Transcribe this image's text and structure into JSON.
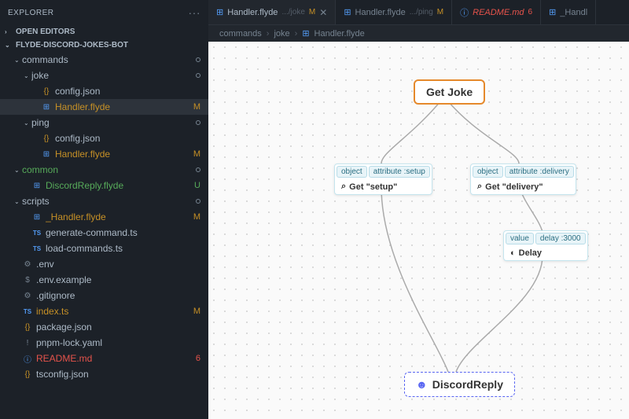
{
  "sidebar": {
    "title": "EXPLORER",
    "sections": {
      "open_editors": "OPEN EDITORS",
      "project": "FLYDE-DISCORD-JOKES-BOT"
    },
    "tree": [
      {
        "indent": 1,
        "chev": "⌄",
        "icon": "",
        "label": "commands",
        "status": "",
        "dot": true
      },
      {
        "indent": 2,
        "chev": "⌄",
        "icon": "",
        "label": "joke",
        "status": "",
        "dot": true
      },
      {
        "indent": 3,
        "chev": "",
        "icon": "{}",
        "iconClass": "json",
        "label": "config.json",
        "status": ""
      },
      {
        "indent": 3,
        "chev": "",
        "icon": "⊞",
        "iconClass": "flyde",
        "label": "Handler.flyde",
        "status": "M",
        "statusClass": "modified",
        "selected": true
      },
      {
        "indent": 2,
        "chev": "⌄",
        "icon": "",
        "label": "ping",
        "status": "",
        "dot": true
      },
      {
        "indent": 3,
        "chev": "",
        "icon": "{}",
        "iconClass": "json",
        "label": "config.json",
        "status": ""
      },
      {
        "indent": 3,
        "chev": "",
        "icon": "⊞",
        "iconClass": "flyde",
        "label": "Handler.flyde",
        "status": "M",
        "statusClass": "modified"
      },
      {
        "indent": 1,
        "chev": "⌄",
        "icon": "",
        "label": "common",
        "status": "",
        "dot": true,
        "statusClass": "untracked"
      },
      {
        "indent": 2,
        "chev": "",
        "icon": "⊞",
        "iconClass": "flyde",
        "label": "DiscordReply.flyde",
        "status": "U",
        "statusClass": "untracked"
      },
      {
        "indent": 1,
        "chev": "⌄",
        "icon": "",
        "label": "scripts",
        "status": "",
        "dot": true
      },
      {
        "indent": 2,
        "chev": "",
        "icon": "⊞",
        "iconClass": "flyde",
        "label": "_Handler.flyde",
        "status": "M",
        "statusClass": "modified"
      },
      {
        "indent": 2,
        "chev": "",
        "icon": "TS",
        "iconClass": "ts",
        "label": "generate-command.ts",
        "status": ""
      },
      {
        "indent": 2,
        "chev": "",
        "icon": "TS",
        "iconClass": "ts",
        "label": "load-commands.ts",
        "status": ""
      },
      {
        "indent": 1,
        "chev": "",
        "icon": "⚙",
        "iconClass": "gear",
        "label": ".env",
        "status": ""
      },
      {
        "indent": 1,
        "chev": "",
        "icon": "$",
        "iconClass": "dollar",
        "label": ".env.example",
        "status": ""
      },
      {
        "indent": 1,
        "chev": "",
        "icon": "⚙",
        "iconClass": "gear",
        "label": ".gitignore",
        "status": ""
      },
      {
        "indent": 1,
        "chev": "",
        "icon": "TS",
        "iconClass": "ts",
        "label": "index.ts",
        "status": "M",
        "statusClass": "modified"
      },
      {
        "indent": 1,
        "chev": "",
        "icon": "{}",
        "iconClass": "json",
        "label": "package.json",
        "status": ""
      },
      {
        "indent": 1,
        "chev": "",
        "icon": "!",
        "iconClass": "excl",
        "label": "pnpm-lock.yaml",
        "status": ""
      },
      {
        "indent": 1,
        "chev": "",
        "icon": "ⓘ",
        "iconClass": "info",
        "label": "README.md",
        "status": "6",
        "statusClass": "deleted"
      },
      {
        "indent": 1,
        "chev": "",
        "icon": "{}",
        "iconClass": "json",
        "label": "tsconfig.json",
        "status": ""
      }
    ]
  },
  "tabs": [
    {
      "icon": "⊞",
      "name": "Handler.flyde",
      "path": ".../joke",
      "badge": "M",
      "badgeClass": "",
      "active": true,
      "close": true
    },
    {
      "icon": "⊞",
      "name": "Handler.flyde",
      "path": ".../ping",
      "badge": "M",
      "badgeClass": ""
    },
    {
      "icon": "ⓘ",
      "name": "README.md",
      "path": "",
      "badge": "6",
      "badgeClass": "del",
      "readme": true
    },
    {
      "icon": "⊞",
      "name": "_Handl",
      "path": "",
      "badge": ""
    }
  ],
  "breadcrumb": [
    "commands",
    "joke",
    "Handler.flyde"
  ],
  "nodes": {
    "get_joke": "Get Joke",
    "setup": {
      "pills": [
        "object",
        "attribute :setup"
      ],
      "body": "Get \"setup\""
    },
    "delivery": {
      "pills": [
        "object",
        "attribute :delivery"
      ],
      "body": "Get \"delivery\""
    },
    "delay": {
      "pills": [
        "value",
        "delay :3000"
      ],
      "body": "Delay"
    },
    "discord": "DiscordReply"
  }
}
